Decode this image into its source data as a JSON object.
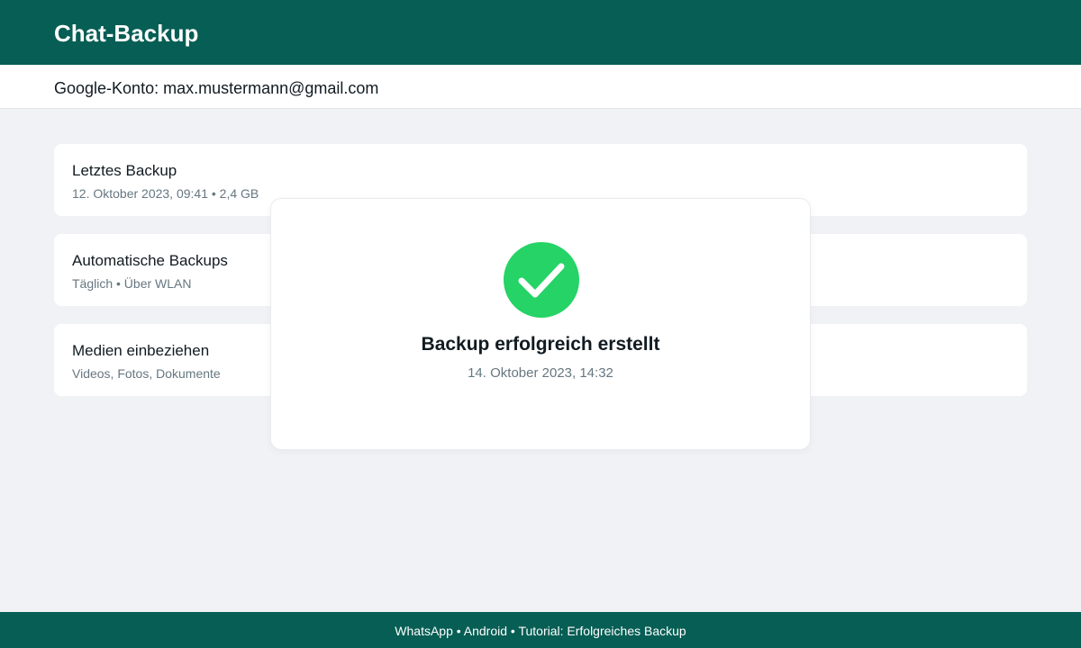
{
  "header": {
    "title": "Chat-Backup"
  },
  "account": {
    "text": "Google-Konto: max.mustermann@gmail.com"
  },
  "cards": [
    {
      "title": "Letztes Backup",
      "subtitle": "12. Oktober 2023, 09:41 • 2,4 GB"
    },
    {
      "title": "Automatische Backups",
      "subtitle": "Täglich • Über WLAN"
    },
    {
      "title": "Medien einbeziehen",
      "subtitle": "Videos, Fotos, Dokumente"
    }
  ],
  "dialog": {
    "icon": "checkmark-circle-icon",
    "title": "Backup erfolgreich erstellt",
    "subtitle": "14. Oktober 2023, 14:32"
  },
  "footer": {
    "text": "WhatsApp • Android • Tutorial: Erfolgreiches Backup"
  },
  "colors": {
    "brand": "#075e54",
    "success": "#25d366",
    "background": "#f0f2f5"
  }
}
